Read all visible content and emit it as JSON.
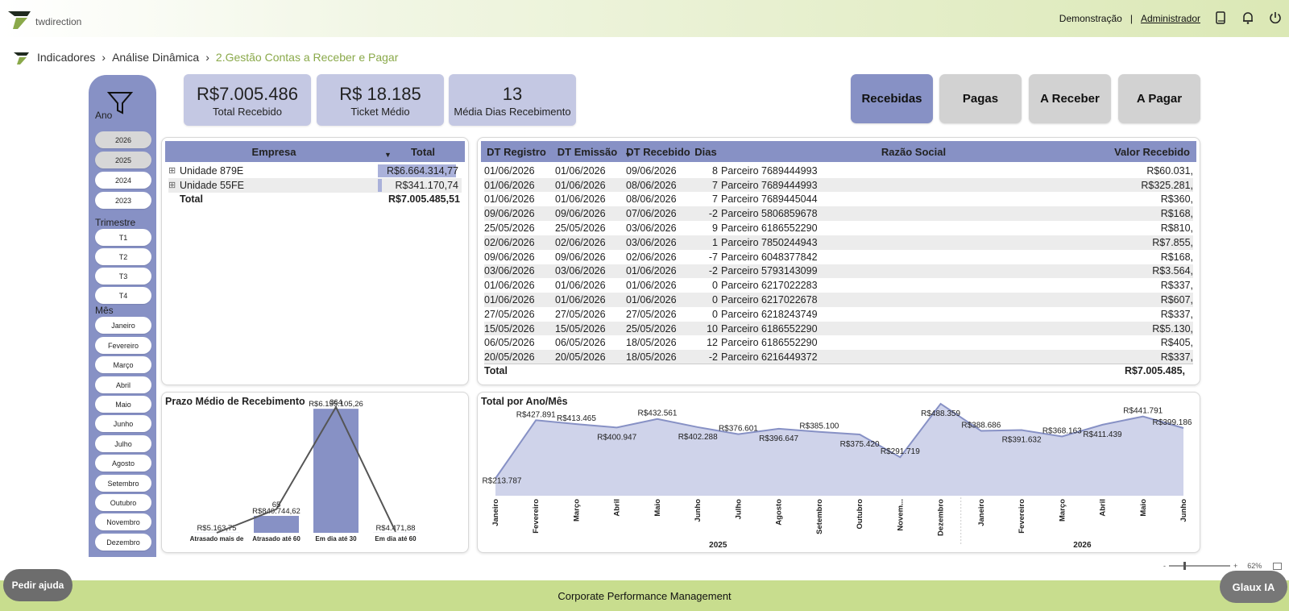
{
  "header": {
    "logo_text": "twdirection",
    "link_demo": "Demonstração",
    "separator": "|",
    "link_admin": "Administrador"
  },
  "breadcrumb": {
    "root": "Indicadores",
    "level2": "Análise Dinâmica",
    "current": "2.Gestão Contas a Receber e Pagar"
  },
  "filters": {
    "ano_label": "Ano",
    "anos": [
      "2026",
      "2025",
      "2024",
      "2023"
    ],
    "trimestre_label": "Trimestre",
    "trimestres": [
      "T1",
      "T2",
      "T3",
      "T4"
    ],
    "mes_label": "Mês",
    "meses": [
      "Janeiro",
      "Fevereiro",
      "Março",
      "Abril",
      "Maio",
      "Junho",
      "Julho",
      "Agosto",
      "Setembro",
      "Outubro",
      "Novembro",
      "Dezembro"
    ]
  },
  "kpis": [
    {
      "value": "R$7.005.486",
      "label": "Total Recebido"
    },
    {
      "value": "R$ 18.185",
      "label": "Ticket Médio"
    },
    {
      "value": "13",
      "label": "Média Dias Recebimento"
    }
  ],
  "nav_buttons": [
    "Recebidas",
    "Pagas",
    "A Receber",
    "A Pagar"
  ],
  "empresa_table": {
    "headers": [
      "Empresa",
      "Total"
    ],
    "rows": [
      {
        "name": "Unidade 879E",
        "total": "R$6.664.314,77",
        "share": 0.95
      },
      {
        "name": "Unidade 55FE",
        "total": "R$341.170,74",
        "share": 0.05
      }
    ],
    "total_label": "Total",
    "total_value": "R$7.005.485,51"
  },
  "detail_table": {
    "headers": [
      "DT Registro",
      "DT Emissão",
      "DT Recebido",
      "Dias",
      "Razão Social",
      "Valor Recebido"
    ],
    "rows": [
      [
        "01/06/2026",
        "01/06/2026",
        "09/06/2026",
        "8",
        "Parceiro 7689444993",
        "R$60.031,"
      ],
      [
        "01/06/2026",
        "01/06/2026",
        "08/06/2026",
        "7",
        "Parceiro 7689444993",
        "R$325.281,"
      ],
      [
        "01/06/2026",
        "01/06/2026",
        "08/06/2026",
        "7",
        "Parceiro 7689445044",
        "R$360,"
      ],
      [
        "09/06/2026",
        "09/06/2026",
        "07/06/2026",
        "-2",
        "Parceiro 5806859678",
        "R$168,"
      ],
      [
        "25/05/2026",
        "25/05/2026",
        "03/06/2026",
        "9",
        "Parceiro 6186552290",
        "R$810,"
      ],
      [
        "02/06/2026",
        "02/06/2026",
        "03/06/2026",
        "1",
        "Parceiro 7850244943",
        "R$7.855,"
      ],
      [
        "09/06/2026",
        "09/06/2026",
        "02/06/2026",
        "-7",
        "Parceiro 6048377842",
        "R$168,"
      ],
      [
        "03/06/2026",
        "03/06/2026",
        "01/06/2026",
        "-2",
        "Parceiro 5793143099",
        "R$3.564,"
      ],
      [
        "01/06/2026",
        "01/06/2026",
        "01/06/2026",
        "0",
        "Parceiro 6217022283",
        "R$337,"
      ],
      [
        "01/06/2026",
        "01/06/2026",
        "01/06/2026",
        "0",
        "Parceiro 6217022678",
        "R$607,"
      ],
      [
        "27/05/2026",
        "27/05/2026",
        "27/05/2026",
        "0",
        "Parceiro 6218243749",
        "R$337,"
      ],
      [
        "15/05/2026",
        "15/05/2026",
        "25/05/2026",
        "10",
        "Parceiro 6186552290",
        "R$5.130,"
      ],
      [
        "06/05/2026",
        "06/05/2026",
        "18/05/2026",
        "12",
        "Parceiro 6186552290",
        "R$405,"
      ],
      [
        "20/05/2026",
        "20/05/2026",
        "18/05/2026",
        "-2",
        "Parceiro 6216449372",
        "R$337,"
      ]
    ],
    "total_label": "Total",
    "total_value": "R$7.005.485,"
  },
  "chart_data": [
    {
      "type": "bar",
      "title": "Prazo Médio de Recebimento",
      "categories": [
        "Atrasado mais de",
        "Atrasado até 60",
        "Em dia até 30",
        "Em dia até 60"
      ],
      "values": [
        5163.75,
        840744.62,
        6155105.26,
        4471.88
      ],
      "value_labels": [
        "R$5.163,75",
        "R$840.744,62",
        "R$6.155.105,26",
        "R$4.471,88"
      ],
      "line_values": [
        -4,
        65,
        364,
        -1
      ],
      "line_labels": [
        "",
        "65",
        "364",
        ""
      ],
      "ylim": [
        0,
        6400000
      ]
    },
    {
      "type": "area",
      "title": "Total por Ano/Mês",
      "categories": [
        "Janeiro",
        "Fevereiro",
        "Março",
        "Abril",
        "Maio",
        "Junho",
        "Julho",
        "Agosto",
        "Setembro",
        "Outubro",
        "Novem...",
        "Dezembro",
        "Janeiro",
        "Fevereiro",
        "Março",
        "Abril",
        "Maio",
        "Junho"
      ],
      "years": [
        "2025",
        "2026"
      ],
      "values": [
        213787,
        427891,
        413465,
        400947,
        432561,
        402288,
        376601,
        396647,
        385100,
        375420,
        291719,
        488359,
        388686,
        391632,
        368163,
        411439,
        441791,
        399186
      ],
      "value_labels": [
        "R$213.787",
        "R$427.891",
        "R$413.465",
        "R$400.947",
        "R$432.561",
        "R$402.288",
        "R$376.601",
        "R$396.647",
        "R$385.100",
        "R$375.420",
        "R$291.719",
        "R$488.359",
        "R$388.686",
        "R$391.632",
        "R$368.163",
        "R$411.439",
        "R$441.791",
        "R$399.186"
      ],
      "ylim": [
        0,
        500000
      ]
    }
  ],
  "footer": {
    "help": "Pedir ajuda",
    "center": "Corporate Performance Management",
    "assistant": "Glaux IA",
    "zoom": "62%",
    "zoom_minus": "-",
    "zoom_plus": "+"
  },
  "colors": {
    "accent": "#8791c5",
    "brand_green": "#8aa94a"
  }
}
